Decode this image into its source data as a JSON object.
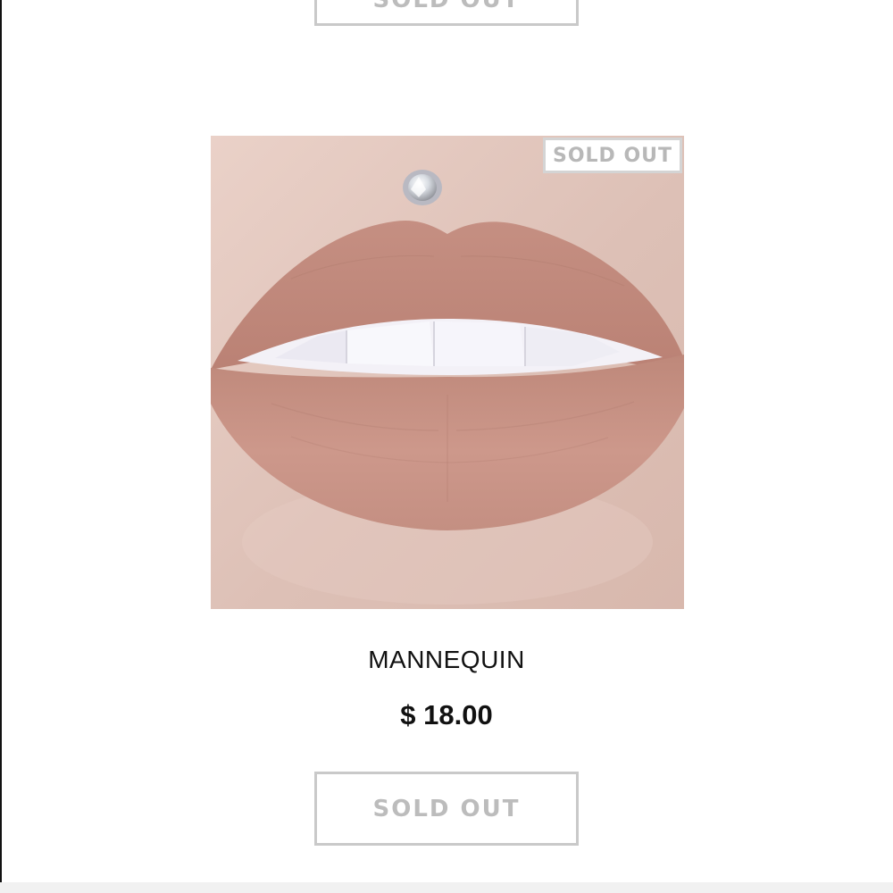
{
  "previous_item": {
    "sold_out_label": "SOLD OUT"
  },
  "product": {
    "image_badge": "SOLD OUT",
    "name": "MANNEQUIN",
    "price": "$ 18.00",
    "sold_out_label": "SOLD OUT",
    "image_subject": "lip swatch photo"
  },
  "colors": {
    "background": "#ffffff",
    "button_border": "#c9c9c9",
    "button_text": "#bcbcbc",
    "text_primary": "#111111",
    "lip_color": "#c99285"
  },
  "icons": {
    "lip_piercing": "stud-icon"
  }
}
